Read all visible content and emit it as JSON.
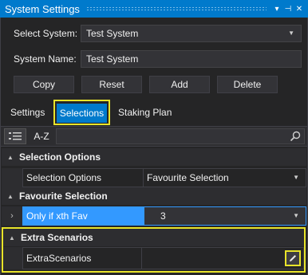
{
  "window": {
    "title": "System Settings",
    "controls": {
      "dropdown_glyph": "▾",
      "pin_glyph": "⊣",
      "close_glyph": "✕"
    }
  },
  "form": {
    "select_system_label": "Select System:",
    "select_system_value": "Test System",
    "system_name_label": "System Name:",
    "system_name_value": "Test System"
  },
  "buttons": {
    "copy": "Copy",
    "reset": "Reset",
    "add": "Add",
    "delete": "Delete"
  },
  "tabs": {
    "settings": "Settings",
    "selections": "Selections",
    "staking_plan": "Staking Plan",
    "active": "Selections"
  },
  "toolbar": {
    "categorized_icon": "categorized-list-icon",
    "alphabetical": "A-Z",
    "search_value": ""
  },
  "grid": {
    "categories": [
      {
        "label": "Selection Options",
        "expanded": true
      },
      {
        "label": "Favourite Selection",
        "expanded": true
      },
      {
        "label": "Extra Scenarios",
        "expanded": true
      }
    ],
    "rows": {
      "selection_options": {
        "name": "Selection Options",
        "value": "Favourite Selection"
      },
      "favourite": {
        "name": "Only if xth Fav",
        "value": "3",
        "selected": true
      },
      "extra": {
        "name": "ExtraScenarios",
        "value": ""
      }
    }
  },
  "colors": {
    "accent": "#007acc",
    "highlight": "#e8e42a",
    "selection": "#3399ff",
    "background": "#252526"
  }
}
